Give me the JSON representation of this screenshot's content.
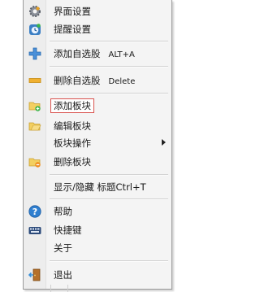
{
  "menu": {
    "items": [
      {
        "label": "界面设置",
        "shortcut": "",
        "icon": "settings-gear-icon"
      },
      {
        "label": "提醒设置",
        "shortcut": "",
        "icon": "alarm-clock-icon"
      },
      {
        "label": "添加自选股",
        "shortcut": "ALT+A",
        "icon": "add-plus-icon"
      },
      {
        "label": "删除自选股",
        "shortcut": "Delete",
        "icon": "delete-minus-icon"
      },
      {
        "label": "添加板块",
        "shortcut": "",
        "icon": "add-folder-icon"
      },
      {
        "label": "编辑板块",
        "shortcut": "",
        "icon": "edit-folder-icon"
      },
      {
        "label": "板块操作",
        "shortcut": "",
        "icon": ""
      },
      {
        "label": "删除板块",
        "shortcut": "",
        "icon": "delete-folder-icon"
      },
      {
        "label": "显示/隐藏 标题Ctrl+T",
        "shortcut": "",
        "icon": ""
      },
      {
        "label": "帮助",
        "shortcut": "",
        "icon": "help-question-icon"
      },
      {
        "label": "快捷键",
        "shortcut": "",
        "icon": "keyboard-icon"
      },
      {
        "label": "关于",
        "shortcut": "",
        "icon": ""
      },
      {
        "label": "退出",
        "shortcut": "",
        "icon": "exit-door-icon"
      }
    ],
    "highlight_color": "#d9534f"
  }
}
